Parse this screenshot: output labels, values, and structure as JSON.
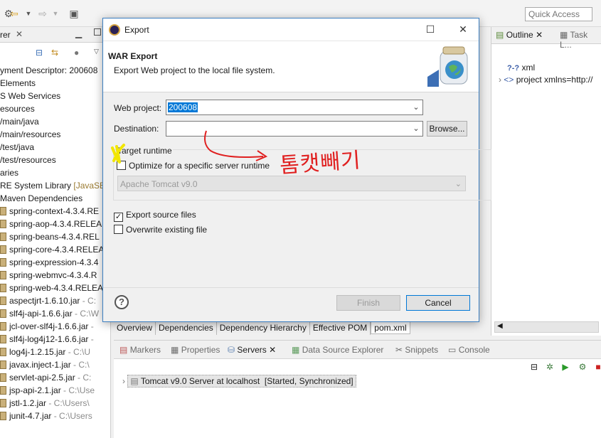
{
  "toolbar": {
    "quick_access": "Quick Access"
  },
  "left_panel": {
    "title": "rer",
    "tree": [
      {
        "text": "yment Descriptor: 200608",
        "suffix": "",
        "jar": false
      },
      {
        "text": "Elements",
        "suffix": "",
        "jar": false
      },
      {
        "text": "S Web Services",
        "suffix": "",
        "jar": false
      },
      {
        "text": "esources",
        "suffix": "",
        "jar": false
      },
      {
        "text": "/main/java",
        "suffix": "",
        "jar": false
      },
      {
        "text": "/main/resources",
        "suffix": "",
        "jar": false
      },
      {
        "text": "/test/java",
        "suffix": "",
        "jar": false
      },
      {
        "text": "/test/resources",
        "suffix": "",
        "jar": false
      },
      {
        "text": "aries",
        "suffix": "",
        "jar": false
      },
      {
        "text": "RE System Library ",
        "suffix": "[JavaSE",
        "jar": false
      },
      {
        "text": "Maven Dependencies",
        "suffix": "",
        "jar": false
      },
      {
        "text": "spring-context-4.3.4.RE",
        "suffix": "",
        "jar": true
      },
      {
        "text": "spring-aop-4.3.4.RELEA",
        "suffix": "",
        "jar": true
      },
      {
        "text": "spring-beans-4.3.4.REL",
        "suffix": "",
        "jar": true
      },
      {
        "text": "spring-core-4.3.4.RELEA",
        "suffix": "",
        "jar": true
      },
      {
        "text": "spring-expression-4.3.4",
        "suffix": "",
        "jar": true
      },
      {
        "text": "spring-webmvc-4.3.4.R",
        "suffix": "",
        "jar": true
      },
      {
        "text": "spring-web-4.3.4.RELEA",
        "suffix": "",
        "jar": true
      },
      {
        "text": "aspectjrt-1.6.10.jar",
        "suffix": " - C:",
        "jar": true
      },
      {
        "text": "slf4j-api-1.6.6.jar",
        "suffix": " - C:\\W",
        "jar": true
      },
      {
        "text": "jcl-over-slf4j-1.6.6.jar",
        "suffix": " -",
        "jar": true
      },
      {
        "text": "slf4j-log4j12-1.6.6.jar",
        "suffix": " -",
        "jar": true
      },
      {
        "text": "log4j-1.2.15.jar",
        "suffix": " - C:\\U",
        "jar": true
      },
      {
        "text": "javax.inject-1.jar",
        "suffix": " - C:\\",
        "jar": true
      },
      {
        "text": "servlet-api-2.5.jar",
        "suffix": " - C:",
        "jar": true
      },
      {
        "text": "jsp-api-2.1.jar",
        "suffix": " - C:\\Use",
        "jar": true
      },
      {
        "text": "jstl-1.2.jar",
        "suffix": " - C:\\Users\\",
        "jar": true
      },
      {
        "text": "junit-4.7.jar",
        "suffix": " - C:\\Users",
        "jar": true
      }
    ]
  },
  "right_panel": {
    "tab_outline": "Outline",
    "tab_task": "Task L...",
    "row_xml": "xml",
    "row_project": "project xmlns=http://"
  },
  "editor_tabs": [
    "Overview",
    "Dependencies",
    "Dependency Hierarchy",
    "Effective POM",
    "pom.xml"
  ],
  "bottom_panel": {
    "tabs": [
      "Markers",
      "Properties",
      "Servers",
      "Data Source Explorer",
      "Snippets",
      "Console"
    ],
    "server_name": "Tomcat v9.0 Server at localhost",
    "server_status": "[Started, Synchronized]"
  },
  "dialog": {
    "title": "Export",
    "banner_title": "WAR Export",
    "banner_desc": "Export Web project to the local file system.",
    "web_project_label": "Web project:",
    "web_project_value": "200608",
    "destination_label": "Destination:",
    "destination_value": "",
    "browse_label": "Browse...",
    "target_runtime_label": "Target runtime",
    "optimize_label": "Optimize for a specific server runtime",
    "optimize_checked": false,
    "runtime_value": "Apache Tomcat v9.0",
    "export_source_label": "Export source files",
    "export_source_checked": true,
    "overwrite_label": "Overwrite existing file",
    "overwrite_checked": false,
    "finish_label": "Finish",
    "cancel_label": "Cancel"
  },
  "annotation": {
    "handwritten_text": "톰캣빼기"
  },
  "colors": {
    "accent": "#0078d7",
    "annotation_red": "#e02020",
    "annotation_yellow": "#f2e600"
  }
}
